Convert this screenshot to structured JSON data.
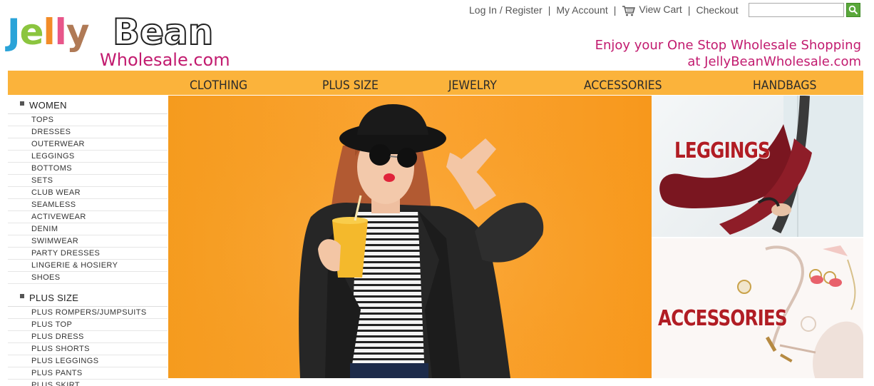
{
  "logo": {
    "jelly": "Jelly",
    "bean": "Bean",
    "wholesale": "Wholesale.com"
  },
  "toplinks": {
    "login": "Log In / Register",
    "account": "My Account",
    "cart": "View Cart",
    "checkout": "Checkout",
    "separator": "|"
  },
  "search": {
    "placeholder": ""
  },
  "tagline": {
    "line1": "Enjoy your One Stop Wholesale Shopping",
    "line2": "at JellyBeanWholesale.com"
  },
  "nav": {
    "items": [
      "CLOTHING",
      "PLUS SIZE",
      "JEWELRY",
      "ACCESSORIES",
      "HANDBAGS"
    ]
  },
  "sidebar": {
    "women": {
      "title": "WOMEN",
      "items": [
        "TOPS",
        "DRESSES",
        "OUTERWEAR",
        "LEGGINGS",
        "BOTTOMS",
        "SETS",
        "CLUB WEAR",
        "SEAMLESS",
        "ACTIVEWEAR",
        "DENIM",
        "SWIMWEAR",
        "PARTY DRESSES",
        "LINGERIE & HOSIERY",
        "SHOES"
      ]
    },
    "plus": {
      "title": "PLUS SIZE",
      "items": [
        "PLUS ROMPERS/JUMPSUITS",
        "PLUS TOP",
        "PLUS DRESS",
        "PLUS SHORTS",
        "PLUS LEGGINGS",
        "PLUS PANTS",
        "PLUS SKIRT"
      ]
    }
  },
  "promos": {
    "leggings": "LEGGINGS",
    "accessories": "ACCESSORIES"
  },
  "colors": {
    "brand_pink": "#c21b6f",
    "nav_orange": "#fbb33b",
    "promo_red": "#b11d24",
    "search_green": "#5aa83b"
  }
}
